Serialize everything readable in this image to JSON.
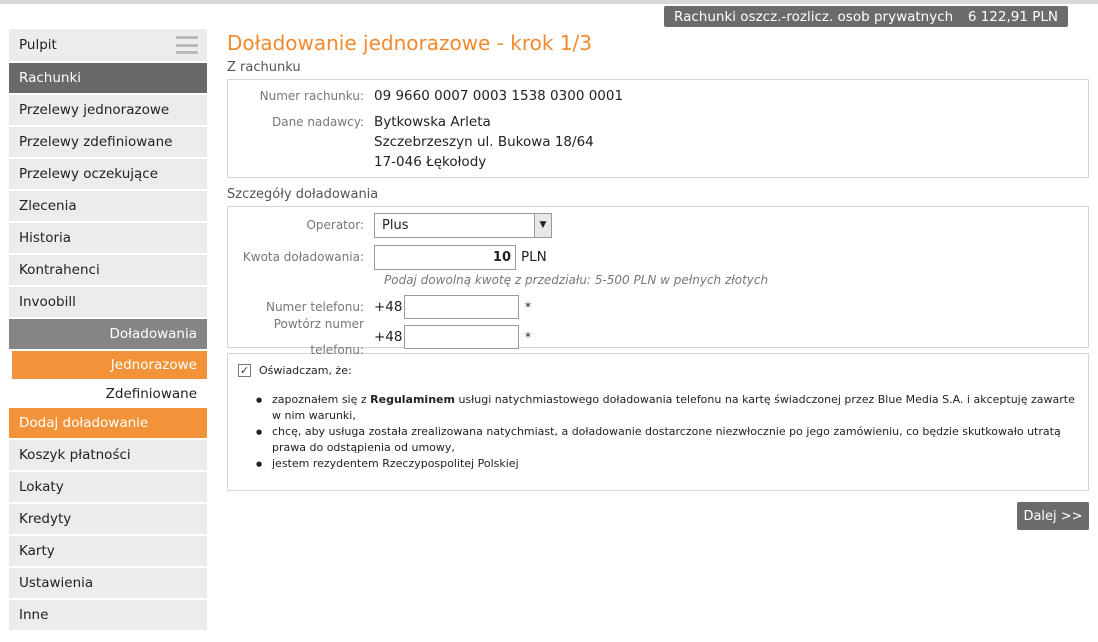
{
  "account": {
    "name": "Rachunki oszcz.-rozlicz. osob prywatnych",
    "balance": "6 122,91 PLN"
  },
  "sidebar": {
    "items": [
      {
        "label": "Pulpit"
      },
      {
        "label": "Rachunki"
      },
      {
        "label": "Przelewy jednorazowe"
      },
      {
        "label": "Przelewy zdefiniowane"
      },
      {
        "label": "Przelewy oczekujące"
      },
      {
        "label": "Zlecenia"
      },
      {
        "label": "Historia"
      },
      {
        "label": "Kontrahenci"
      },
      {
        "label": "Invoobill"
      },
      {
        "label": "Doładowania"
      },
      {
        "label": "Jednorazowe"
      },
      {
        "label": "Zdefiniowane"
      },
      {
        "label": "Dodaj doładowanie"
      },
      {
        "label": "Koszyk płatności"
      },
      {
        "label": "Lokaty"
      },
      {
        "label": "Kredyty"
      },
      {
        "label": "Karty"
      },
      {
        "label": "Ustawienia"
      },
      {
        "label": "Inne"
      }
    ]
  },
  "page": {
    "title": "Doładowanie jednorazowe - krok 1/3"
  },
  "from_account": {
    "section_label": "Z rachunku",
    "number_label": "Numer rachunku:",
    "number_value": "09 9660 0007 0003 1538 0300 0001",
    "sender_label": "Dane nadawcy:",
    "sender_lines": [
      "Bytkowska Arleta",
      "Szczebrzeszyn ul. Bukowa 18/64",
      "17-046 Łękołody"
    ]
  },
  "details": {
    "section_label": "Szczegóły doładowania",
    "operator_label": "Operator:",
    "operator_value": "Plus",
    "amount_label": "Kwota doładowania:",
    "amount_value": "10",
    "amount_unit": "PLN",
    "amount_hint": "Podaj dowolną kwotę z przedziału: 5-500 PLN w pełnych złotych",
    "phone_label": "Numer telefonu:",
    "phone_repeat_label": "Powtórz numer telefonu:",
    "phone_prefix": "+48",
    "required_mark": "*"
  },
  "declaration": {
    "checked_mark": "✓",
    "heading": "Oświadczam, że:",
    "item1_pre": "zapoznałem się z ",
    "item1_bold": "Regulaminem",
    "item1_post": " usługi natychmiastowego doładowania telefonu na kartę świadczonej przez Blue Media S.A. i akceptuję zawarte w nim warunki,",
    "item2": "chcę, aby usługa została zrealizowana natychmiast, a doładowanie dostarczone niezwłocznie po jego zamówieniu, co będzie skutkowało utratą prawa do odstąpienia od umowy,",
    "item3": "jestem rezydentem Rzeczypospolitej Polskiej"
  },
  "actions": {
    "next_label": "Dalej >>"
  }
}
